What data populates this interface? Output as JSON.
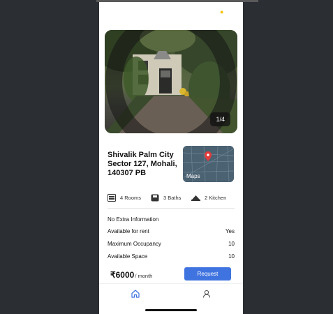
{
  "listing": {
    "title_line1": "Shivalik Palm City",
    "title_line2": "Sector 127, Mohali,",
    "title_line3": "140307 PB",
    "photo_counter": "1/4"
  },
  "map": {
    "label": "Maps"
  },
  "features": {
    "rooms": "4 Rooms",
    "baths": "3 Baths",
    "kitchen": "2 Kitchen"
  },
  "details": {
    "extra_info": "No Extra Information",
    "rows": [
      {
        "label": "Available for rent",
        "value": "Yes"
      },
      {
        "label": "Maximum Occupancy",
        "value": "10"
      },
      {
        "label": "Available Space",
        "value": "10"
      }
    ]
  },
  "pricing": {
    "amount": "₹6000",
    "unit": "/ month",
    "request_label": "Request"
  },
  "nav": {
    "items": [
      {
        "icon": "home-icon",
        "active": true
      },
      {
        "icon": "profile-icon",
        "active": false
      }
    ]
  },
  "colors": {
    "accent": "#3f73e0",
    "status_dot": "#f5c400"
  }
}
